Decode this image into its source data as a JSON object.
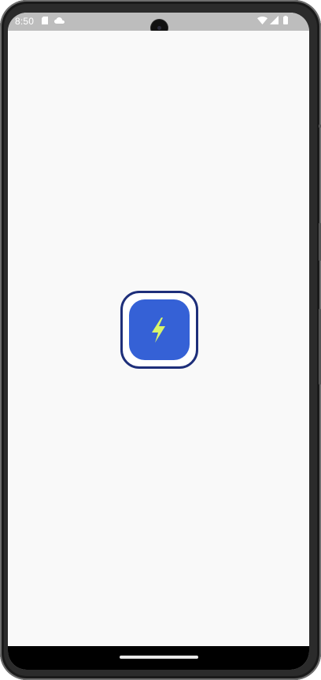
{
  "status_bar": {
    "time": "8:50",
    "left_icons": [
      "sd-card-icon",
      "cloud-icon"
    ],
    "right_icons": [
      "wifi-icon",
      "signal-icon",
      "battery-icon"
    ]
  },
  "main": {
    "center_icon": "lightning-bolt-icon"
  },
  "colors": {
    "icon_border": "#1e2f7a",
    "icon_fill": "#3561d6",
    "bolt": "#d9f56a",
    "background": "#f9f9f9",
    "status_bar": "#bdbdbd"
  }
}
